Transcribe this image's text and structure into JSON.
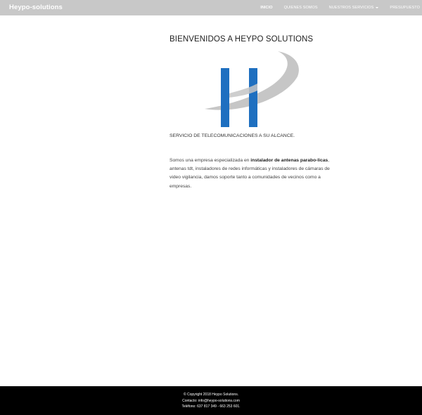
{
  "header": {
    "brand": "Heypo-solutions",
    "nav": {
      "inicio": "INICIO",
      "quienes": "QUIENES SOMOS",
      "servicios": "NUESTROS SERVICIOS",
      "presupuesto": "PRESUPUESTO"
    }
  },
  "main": {
    "title": "BIENVENIDOS A HEYPO SOLUTIONS",
    "tagline": "SERVICIO DE TELECOMUNICACIONES A SU ALCANCE.",
    "paragraph": {
      "part1": "Somos una empresa especializada en ",
      "bold": "instalador de antenas parabo-licas",
      "part2": ", antenas tdt, instaladores de redes informáticas y instaladores de cámaras de video vigilancia, damos soporte tanto a comunidades de vecinos como a empresas."
    }
  },
  "footer": {
    "copyright": "© Copyright 2018 Heypo Solutions.",
    "contact": "Contacto: info@heypo-solutions.com",
    "phone": "Teléfono: 637 817 349 - 663 253 601."
  },
  "colors": {
    "topbar": "#c8c8c8",
    "logo_blue": "#1e6fc0",
    "logo_grey": "#c6c6c6",
    "footer": "#000000"
  }
}
